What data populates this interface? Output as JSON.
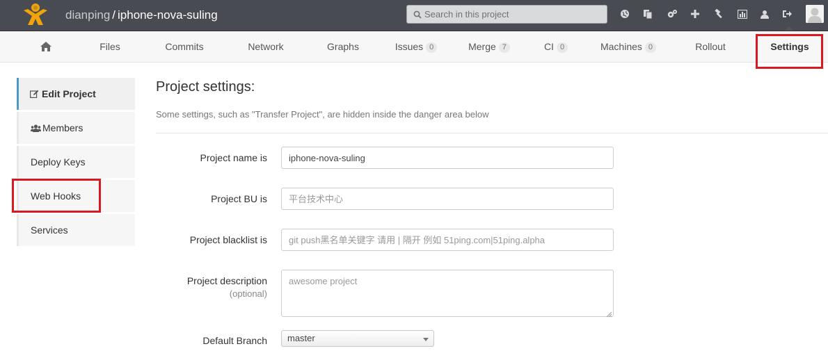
{
  "header": {
    "namespace": "dianping",
    "separator": "/",
    "project": "iphone-nova-suling",
    "search_placeholder": "Search in this project",
    "icons": [
      "globe-icon",
      "copy-icon",
      "cogs-icon",
      "plus-icon",
      "hammer-icon",
      "chart-icon",
      "user-icon",
      "sign-out-icon"
    ]
  },
  "nav": {
    "tabs": [
      {
        "label": "",
        "icon": "home-icon"
      },
      {
        "label": "Files"
      },
      {
        "label": "Commits"
      },
      {
        "label": "Network"
      },
      {
        "label": "Graphs"
      },
      {
        "label": "Issues",
        "badge": "0"
      },
      {
        "label": "Merge",
        "badge": "7"
      },
      {
        "label": "CI",
        "badge": "0"
      },
      {
        "label": "Machines",
        "badge": "0"
      },
      {
        "label": "Rollout"
      },
      {
        "label": "Settings"
      }
    ],
    "active": "Settings"
  },
  "sidebar": {
    "items": [
      {
        "label": "Edit Project",
        "icon": "edit-icon"
      },
      {
        "label": "Members",
        "icon": "group-icon"
      },
      {
        "label": "Deploy Keys"
      },
      {
        "label": "Web Hooks"
      },
      {
        "label": "Services"
      }
    ]
  },
  "main": {
    "title": "Project settings:",
    "subtitle": "Some settings, such as \"Transfer Project\", are hidden inside the danger area below",
    "fields": {
      "name_label": "Project name is",
      "name_value": "iphone-nova-suling",
      "bu_label": "Project BU is",
      "bu_placeholder": "平台技术中心",
      "blacklist_label": "Project blacklist is",
      "blacklist_placeholder": "git push黑名单关键字 请用 | 隔开 例如 51ping.com|51ping.alpha",
      "description_label": "Project description",
      "description_optional": "(optional)",
      "description_placeholder": "awesome project",
      "branch_label": "Default Branch",
      "branch_value": "master"
    }
  },
  "colors": {
    "header_bg": "#484b51",
    "highlight": "#d71920",
    "sidebar_accent": "#4a9bc7",
    "logo": "#f0a30a"
  }
}
